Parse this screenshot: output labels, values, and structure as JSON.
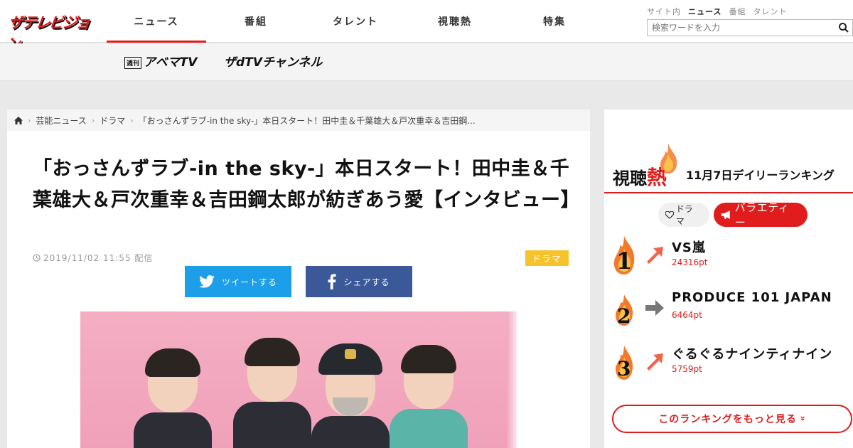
{
  "header": {
    "logo_text": "ザテレビジョン",
    "nav": [
      "ニュース",
      "番組",
      "タレント",
      "視聴熱",
      "特集"
    ],
    "search_scopes": [
      "サイト内",
      "ニュース",
      "番組",
      "タレント"
    ],
    "search_placeholder": "検索ワードを入力"
  },
  "subbar": {
    "abema_tag": "週刊",
    "abema_label": "アベマTV",
    "dtv_label": "ザdTVチャンネル"
  },
  "article": {
    "breadcrumb": [
      "芸能ニュース",
      "ドラマ",
      "「おっさんずラブ-in the sky-」本日スタート！田中圭＆千葉雄大＆戸次重幸＆吉田鋼..."
    ],
    "title": "「おっさんずラブ-in the sky-」本日スタート！田中圭＆千葉雄大＆戸次重幸＆吉田鋼太郎が紡ぎあう愛【インタビュー】",
    "date": "2019/11/02 11:55 配信",
    "category": "ドラマ",
    "tweet_label": "ツイートする",
    "share_label": "シェアする"
  },
  "ranking": {
    "logo_prefix": "視聴",
    "logo_hot": "熱",
    "date_label": "11月7日デイリーランキング",
    "tabs": [
      "ドラマ",
      "バラエティー"
    ],
    "items": [
      {
        "rank": "1",
        "title": "VS嵐",
        "points": "24316pt",
        "trend": "up"
      },
      {
        "rank": "2",
        "title": "PRODUCE 101 JAPAN",
        "points": "6464pt",
        "trend": "flat"
      },
      {
        "rank": "3",
        "title": "ぐるぐるナインティナイン",
        "points": "5759pt",
        "trend": "up"
      }
    ],
    "more_label": "このランキングをもっと見る"
  },
  "colors": {
    "brand_red": "#e01c1c",
    "twitter_blue": "#1d9ee9",
    "facebook_blue": "#3b5998",
    "badge_yellow": "#f5c42c"
  }
}
